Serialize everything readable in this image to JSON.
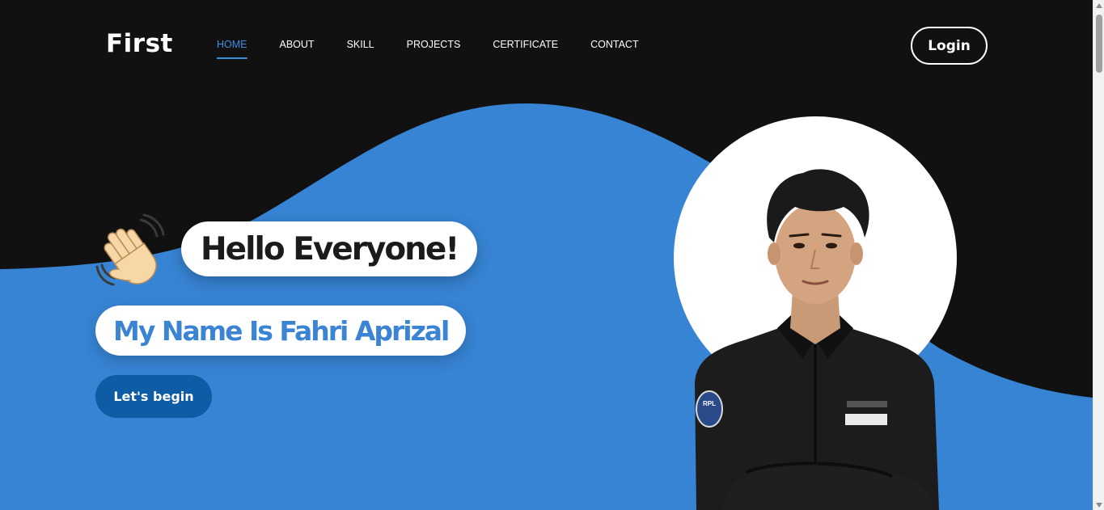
{
  "brand": "First",
  "nav": {
    "links": [
      {
        "label": "HOME",
        "active": true
      },
      {
        "label": "ABOUT",
        "active": false
      },
      {
        "label": "SKILL",
        "active": false
      },
      {
        "label": "PROJECTS",
        "active": false
      },
      {
        "label": "CERTIFICATE",
        "active": false
      },
      {
        "label": "CONTACT",
        "active": false
      }
    ],
    "login_label": "Login"
  },
  "hero": {
    "greeting_icon": "waving-hand-emoji",
    "greeting": "Hello Everyone!",
    "name_line": "My Name Is Fahri Aprizal",
    "cta_label": "Let's begin"
  },
  "portrait": {
    "icon": "person-portrait-photo",
    "badge_text": "RPL"
  },
  "colors": {
    "background_dark": "#111111",
    "accent_blue": "#3784d4",
    "button_blue": "#0f5ca6",
    "nav_active": "#3f8fe0",
    "white": "#ffffff"
  }
}
